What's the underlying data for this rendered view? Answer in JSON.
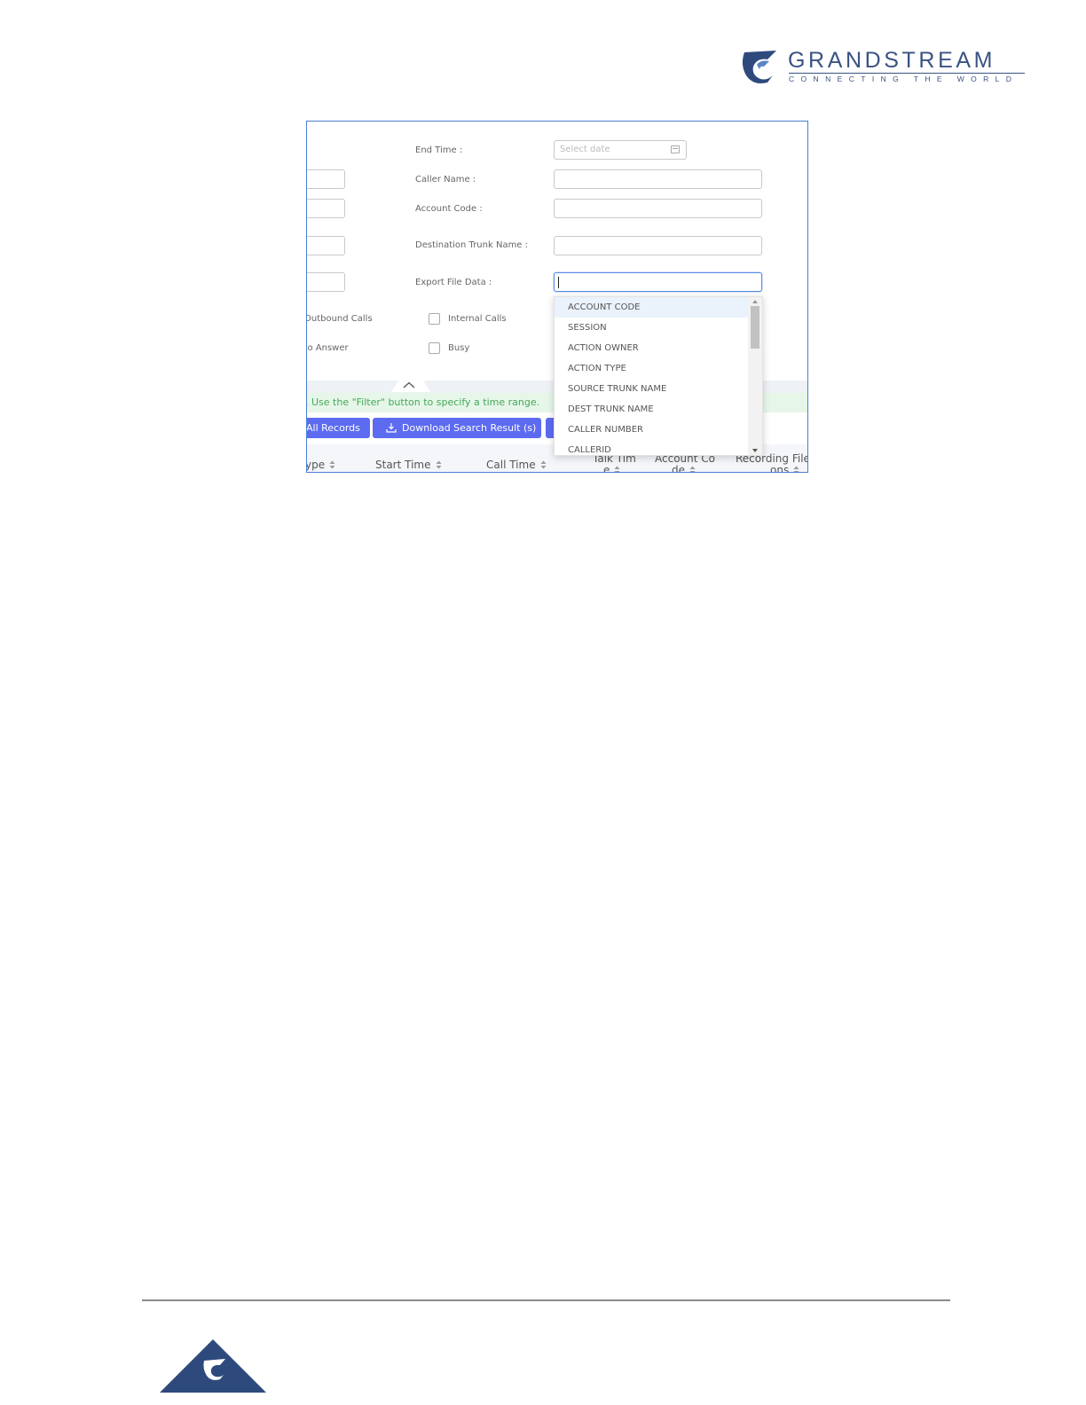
{
  "header": {
    "brand_name": "GRANDSTREAM",
    "brand_tagline": "CONNECTING THE WORLD",
    "brand_color": "#3a5383"
  },
  "form": {
    "end_time_label": "End Time :",
    "end_time_placeholder": "Select date",
    "caller_name_label": "Caller Name :",
    "account_code_label": "Account Code :",
    "dest_trunk_label": "Destination Trunk Name :",
    "export_file_data_label": "Export File Data :"
  },
  "filters": {
    "outbound_calls": "Outbound Calls",
    "internal_calls": "Internal Calls",
    "no_answer": "No Answer",
    "busy": "Busy"
  },
  "notice": {
    "text": ". Use the \"Filter\" button to specify a time range.",
    "color": "#46a758"
  },
  "buttons": {
    "all_records": "All Records",
    "download_search_result": "Download Search Result (s)",
    "accent": "#5d6bf0"
  },
  "table": {
    "headers": {
      "type": "ype",
      "start_time": "Start Time",
      "call_time": "Call Time",
      "talk_time_l1": "Talk Tim",
      "talk_time_l2": "e",
      "account_code_l1": "Account Co",
      "account_code_l2": "de",
      "recording_l1": "Recording File",
      "recording_l2": "ons"
    }
  },
  "export_dropdown": {
    "options": [
      "ACCOUNT CODE",
      "SESSION",
      "ACTION OWNER",
      "ACTION TYPE",
      "SOURCE TRUNK NAME",
      "DEST TRUNK NAME",
      "CALLER NUMBER",
      "CALLERID"
    ],
    "highlighted_option": "ACCOUNT CODE"
  }
}
